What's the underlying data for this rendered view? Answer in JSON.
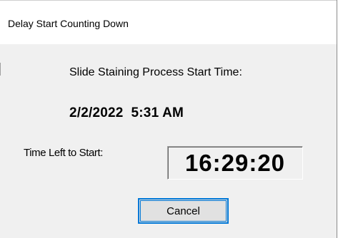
{
  "window": {
    "title": "Delay Start Counting Down"
  },
  "dialog": {
    "heading": "Slide Staining Process Start Time:",
    "start_datetime": "2/2/2022  5:31 AM",
    "time_left_label": "Time Left to Start:",
    "countdown": "16:29:20",
    "cancel_label": "Cancel"
  },
  "colors": {
    "dialog_background": "#f0f0f0",
    "title_background": "#ffffff",
    "button_focus_border": "#0078d7",
    "button_face": "#e1e1e1"
  }
}
